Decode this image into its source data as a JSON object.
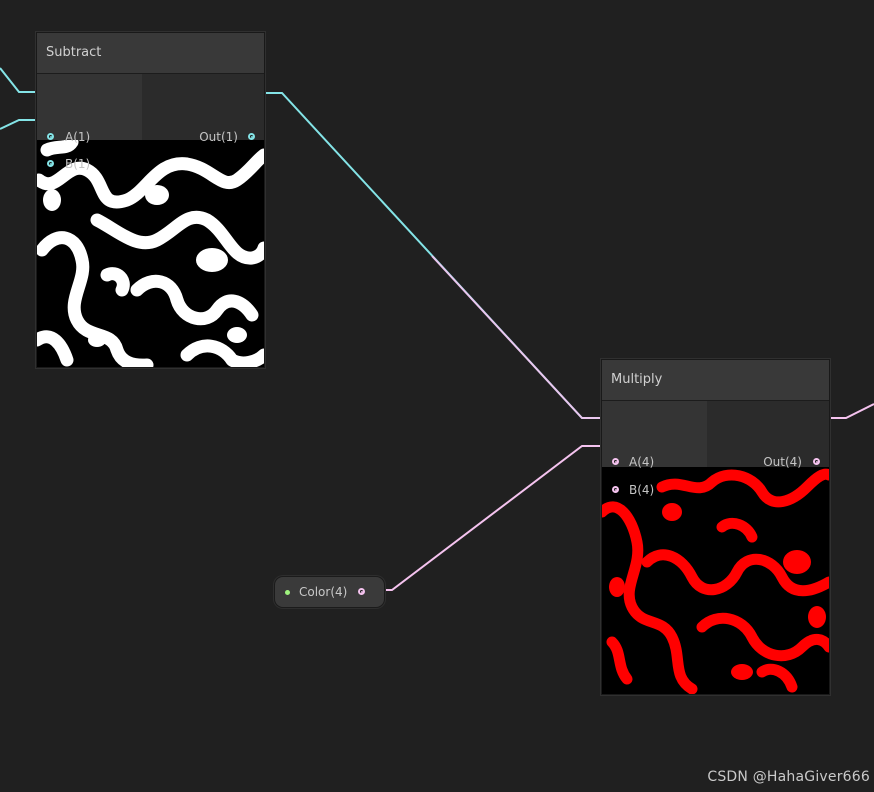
{
  "nodes": {
    "subtract": {
      "title": "Subtract",
      "inputs": [
        "A(1)",
        "B(1)"
      ],
      "output": "Out(1)"
    },
    "multiply": {
      "title": "Multiply",
      "inputs": [
        "A(4)",
        "B(4)"
      ],
      "output": "Out(4)"
    },
    "color_property": {
      "label": "Color(4)"
    }
  },
  "colors": {
    "background": "#202020",
    "float_wire": "#84e4e7",
    "vector4_wire": "#f5c3ef",
    "property_dot": "#9ff37e",
    "subtract_preview_fg": "#ffffff",
    "multiply_preview_fg": "#ff0000"
  },
  "watermark": "CSDN @HahaGiver666"
}
